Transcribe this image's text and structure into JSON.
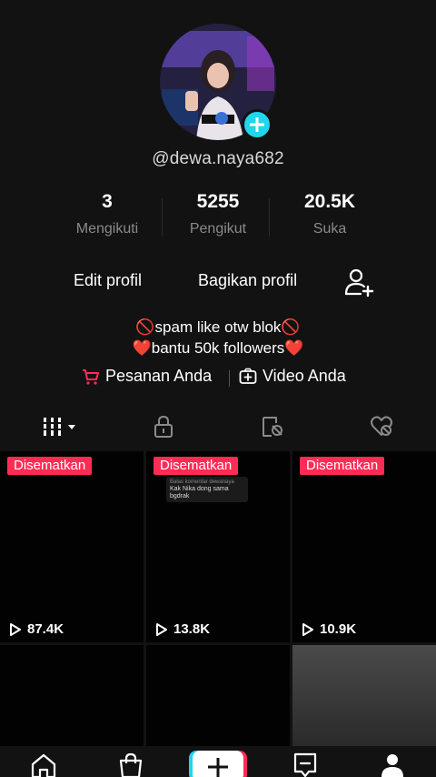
{
  "profile": {
    "username": "@dewa.naya682",
    "stats": [
      {
        "value": "3",
        "label": "Mengikuti"
      },
      {
        "value": "5255",
        "label": "Pengikut"
      },
      {
        "value": "20.5K",
        "label": "Suka"
      }
    ],
    "edit_label": "Edit profil",
    "share_label": "Bagikan profil",
    "bio_line1": "🚫spam like otw blok🚫",
    "bio_line2": "❤️bantu 50k followers❤️",
    "orders_label": "Pesanan Anda",
    "videos_label": "Video Anda"
  },
  "videos": [
    {
      "pinned": "Disematkan",
      "views": "87.4K"
    },
    {
      "pinned": "Disematkan",
      "views": "13.8K",
      "overlay_title": "Balas komentar dewanaya",
      "overlay_text": "Kak Nika dong sama bgdrak"
    },
    {
      "pinned": "Disematkan",
      "views": "10.9K"
    }
  ],
  "colors": {
    "accent": "#fe2c55",
    "cyan": "#20d5ec",
    "background": "#121212"
  },
  "icons": [
    "add-icon",
    "add-friend-icon",
    "cart-icon",
    "video-add-icon",
    "grid-icon",
    "lock-icon",
    "tagged-icon",
    "liked-icon",
    "play-icon",
    "home-icon",
    "shop-icon",
    "plus-icon",
    "inbox-icon",
    "profile-icon"
  ]
}
